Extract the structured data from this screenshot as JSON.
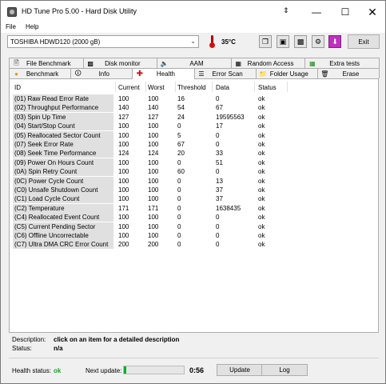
{
  "titlebar": {
    "title": "HD Tune Pro 5.00 - Hard Disk Utility",
    "arrows": "⇕"
  },
  "menu": {
    "file": "File",
    "help": "Help"
  },
  "toolbar": {
    "drive": "TOSHIBA HDWD120 (2000 gB)",
    "temperature": "35°C",
    "exit": "Exit"
  },
  "tabs_row1": [
    {
      "label": "File Benchmark",
      "icon": "file-benchmark-icon"
    },
    {
      "label": "Disk monitor",
      "icon": "disk-monitor-icon"
    },
    {
      "label": "AAM",
      "icon": "speaker-icon"
    },
    {
      "label": "Random Access",
      "icon": "random-access-icon"
    },
    {
      "label": "Extra tests",
      "icon": "extra-tests-icon"
    }
  ],
  "tabs_row2": [
    {
      "label": "Benchmark",
      "icon": "benchmark-icon"
    },
    {
      "label": "Info",
      "icon": "info-icon"
    },
    {
      "label": "Health",
      "icon": "health-cross-icon"
    },
    {
      "label": "Error Scan",
      "icon": "error-scan-icon"
    },
    {
      "label": "Folder Usage",
      "icon": "folder-icon"
    },
    {
      "label": "Erase",
      "icon": "trash-icon"
    }
  ],
  "table": {
    "headers": [
      "ID",
      "Current",
      "Worst",
      "Threshold",
      "Data",
      "Status"
    ],
    "rows": [
      [
        "(01) Raw Read Error Rate",
        "100",
        "100",
        "16",
        "0",
        "ok"
      ],
      [
        "(02) Throughput Performance",
        "140",
        "140",
        "54",
        "67",
        "ok"
      ],
      [
        "(03) Spin Up Time",
        "127",
        "127",
        "24",
        "19595563",
        "ok"
      ],
      [
        "(04) Start/Stop Count",
        "100",
        "100",
        "0",
        "17",
        "ok"
      ],
      [
        "(05) Reallocated Sector Count",
        "100",
        "100",
        "5",
        "0",
        "ok"
      ],
      [
        "(07) Seek Error Rate",
        "100",
        "100",
        "67",
        "0",
        "ok"
      ],
      [
        "(08) Seek Time Performance",
        "124",
        "124",
        "20",
        "33",
        "ok"
      ],
      [
        "(09) Power On Hours Count",
        "100",
        "100",
        "0",
        "51",
        "ok"
      ],
      [
        "(0A) Spin Retry Count",
        "100",
        "100",
        "60",
        "0",
        "ok"
      ],
      [
        "(0C) Power Cycle Count",
        "100",
        "100",
        "0",
        "13",
        "ok"
      ],
      [
        "(C0) Unsafe Shutdown Count",
        "100",
        "100",
        "0",
        "37",
        "ok"
      ],
      [
        "(C1) Load Cycle Count",
        "100",
        "100",
        "0",
        "37",
        "ok"
      ],
      [
        "(C2) Temperature",
        "171",
        "171",
        "0",
        "1638435",
        "ok"
      ],
      [
        "(C4) Reallocated Event Count",
        "100",
        "100",
        "0",
        "0",
        "ok"
      ],
      [
        "(C5) Current Pending Sector",
        "100",
        "100",
        "0",
        "0",
        "ok"
      ],
      [
        "(C6) Offline Uncorrectable",
        "100",
        "100",
        "0",
        "0",
        "ok"
      ],
      [
        "(C7) Ultra DMA CRC Error Count",
        "200",
        "200",
        "0",
        "0",
        "ok"
      ]
    ]
  },
  "description": {
    "label": "Description:",
    "value": "click on an item for a detailed description",
    "status_label": "Status:",
    "status_value": "n/a"
  },
  "statusbar": {
    "health_label": "Health status:",
    "health_value": "ok",
    "next_update_label": "Next update:",
    "progress_fraction": 0.04,
    "countdown": "0:56",
    "update_button": "Update",
    "log_button": "Log"
  },
  "colors": {
    "health_ok": "#1aa02a",
    "progress_fill": "#06b025",
    "health_icon": "#d01010"
  }
}
